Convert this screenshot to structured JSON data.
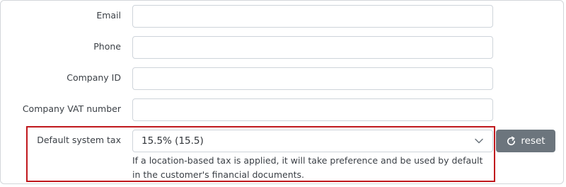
{
  "form": {
    "fields": [
      {
        "label": "Email",
        "value": ""
      },
      {
        "label": "Phone",
        "value": ""
      },
      {
        "label": "Company ID",
        "value": ""
      },
      {
        "label": "Company VAT number",
        "value": ""
      }
    ],
    "default_tax": {
      "label": "Default system tax",
      "selected": "15.5% (15.5)",
      "hint": "If a location-based tax is applied, it will take preference and be used by default in the customer's financial documents."
    },
    "reset_button": {
      "label": "reset",
      "icon": "refresh-icon"
    }
  },
  "colors": {
    "highlight_border": "#c0181d",
    "reset_bg": "#6c757d",
    "input_border": "#ced4da"
  }
}
